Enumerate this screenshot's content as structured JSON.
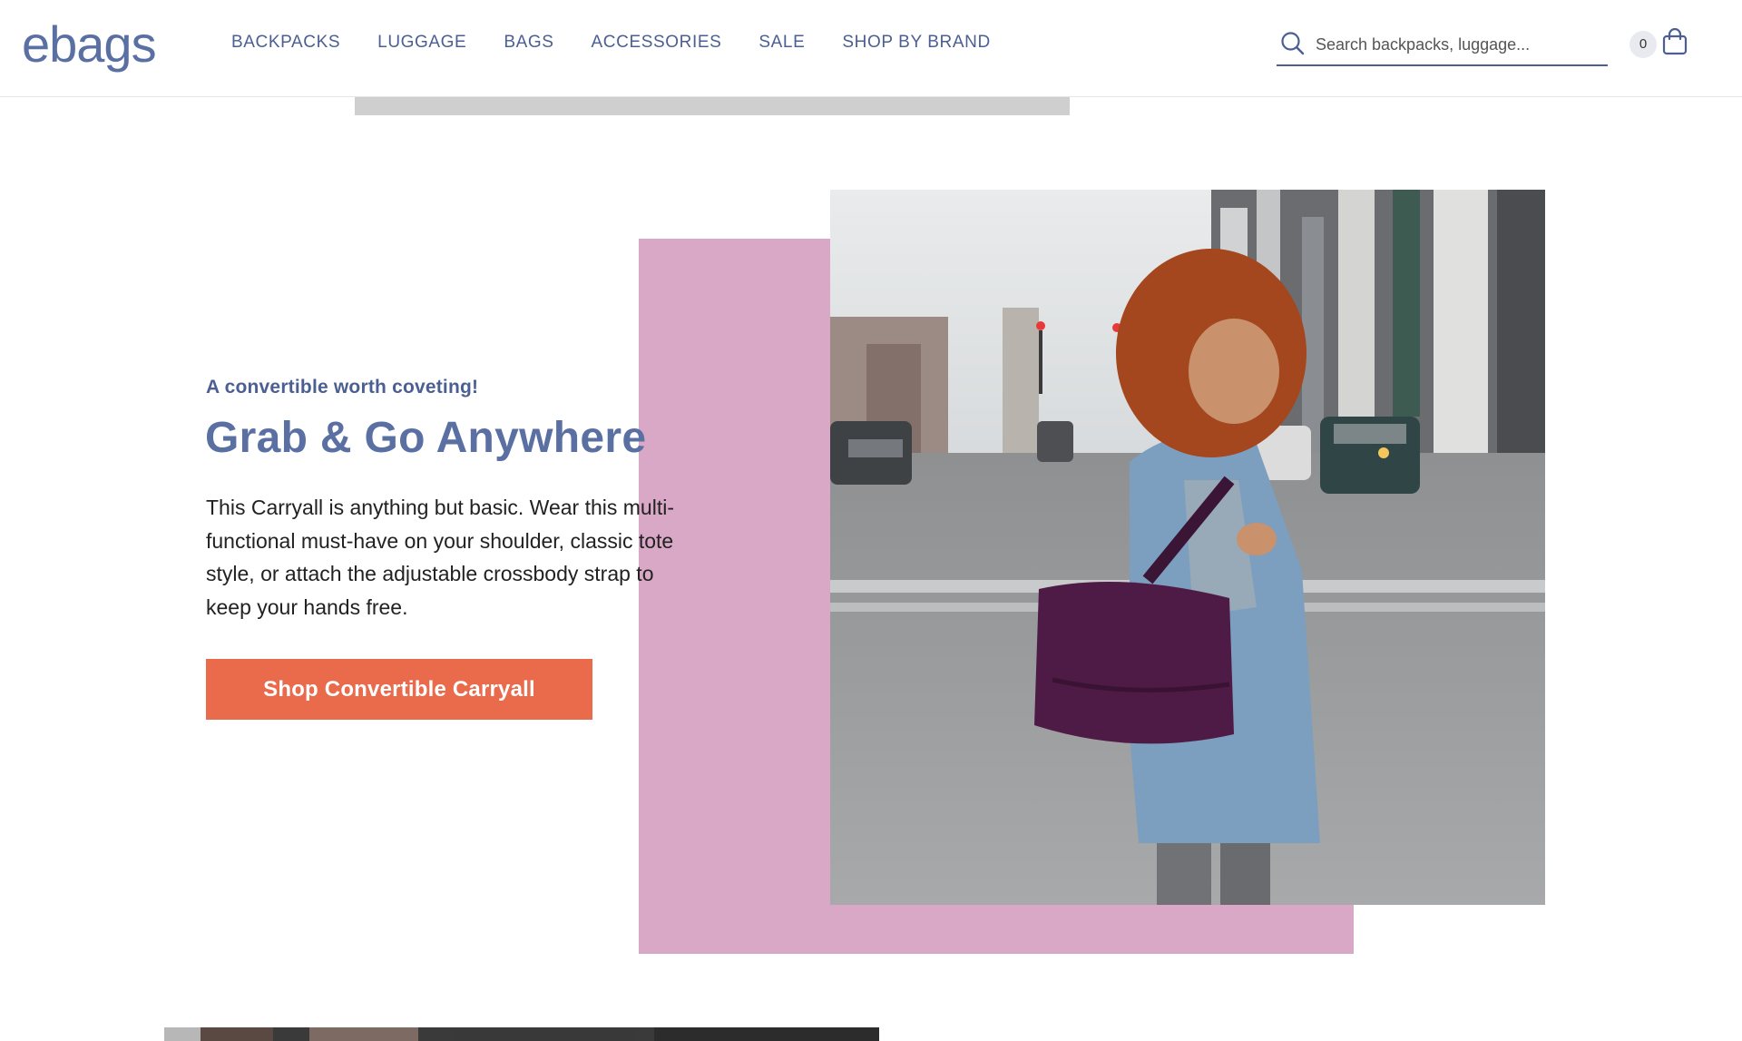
{
  "header": {
    "logo": "ebags",
    "nav": [
      "BACKPACKS",
      "LUGGAGE",
      "BAGS",
      "ACCESSORIES",
      "SALE",
      "SHOP BY BRAND"
    ],
    "search": {
      "placeholder": "Search backpacks, luggage..."
    },
    "cart_count": "0"
  },
  "promo": {
    "eyebrow": "A convertible worth coveting!",
    "headline": "Grab & Go Anywhere",
    "body": "This Carryall is anything but basic. Wear this multi-functional must-have on your shoulder, classic tote style, or attach the adjustable crossbody strap to keep your hands free.",
    "cta_label": "Shop Convertible Carryall"
  },
  "colors": {
    "brand": "#5a6fa2",
    "accent_cta": "#ea6a4c",
    "pink_block": "#d9a8c6"
  },
  "icons": [
    "search-icon",
    "shopping-bag-icon"
  ]
}
